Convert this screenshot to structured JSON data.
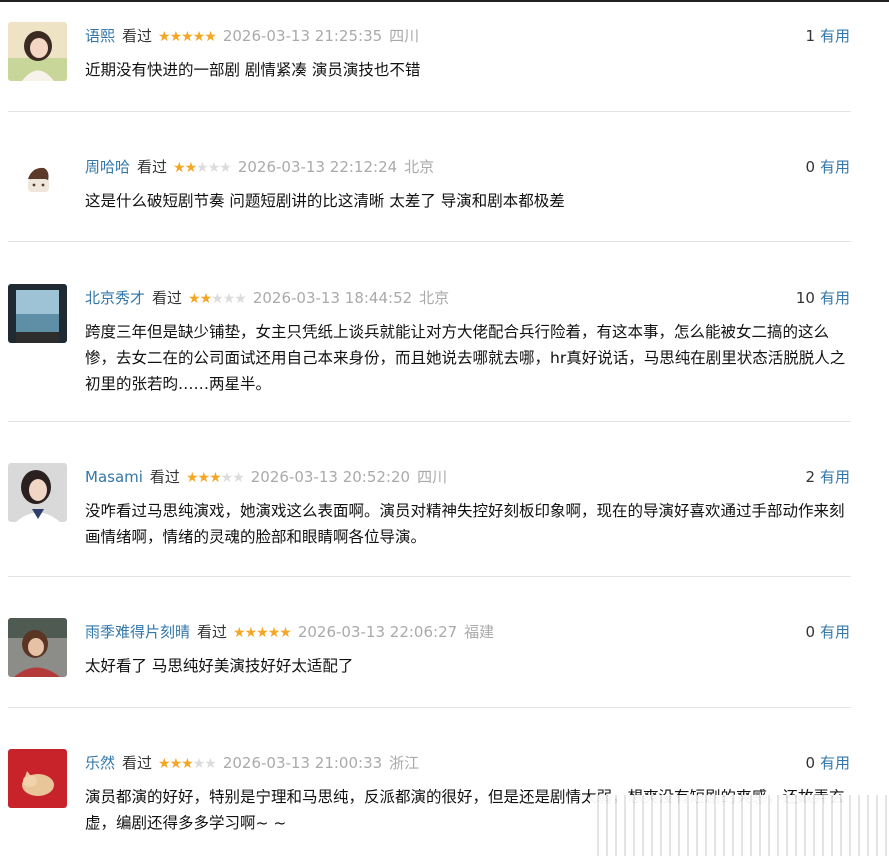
{
  "reviews": [
    {
      "name": "语熙",
      "watched": "看过",
      "stars": 5,
      "date": "2026-03-13 21:25:35",
      "location": "四川",
      "votes": "1",
      "useful": "有用",
      "content": "近期没有快进的一部剧 剧情紧凑 演员演技也不错"
    },
    {
      "name": "周哈哈",
      "watched": "看过",
      "stars": 2,
      "date": "2026-03-13 22:12:24",
      "location": "北京",
      "votes": "0",
      "useful": "有用",
      "content": "这是什么破短剧节奏 问题短剧讲的比这清晰 太差了 导演和剧本都极差"
    },
    {
      "name": "北京秀才",
      "watched": "看过",
      "stars": 2,
      "date": "2026-03-13 18:44:52",
      "location": "北京",
      "votes": "10",
      "useful": "有用",
      "content": "跨度三年但是缺少铺垫，女主只凭纸上谈兵就能让对方大佬配合兵行险着，有这本事，怎么能被女二搞的这么惨，去女二在的公司面试还用自己本来身份，而且她说去哪就去哪，hr真好说话，马思纯在剧里状态活脱脱人之初里的张若昀……两星半。"
    },
    {
      "name": "Masami",
      "watched": "看过",
      "stars": 3,
      "date": "2026-03-13 20:52:20",
      "location": "四川",
      "votes": "2",
      "useful": "有用",
      "content": "没咋看过马思纯演戏，她演戏这么表面啊。演员对精神失控好刻板印象啊，现在的导演好喜欢通过手部动作来刻画情绪啊，情绪的灵魂的脸部和眼睛啊各位导演。"
    },
    {
      "name": "雨季难得片刻晴",
      "watched": "看过",
      "stars": 5,
      "date": "2026-03-13 22:06:27",
      "location": "福建",
      "votes": "0",
      "useful": "有用",
      "content": "太好看了 马思纯好美演技好好太适配了"
    },
    {
      "name": "乐然",
      "watched": "看过",
      "stars": 3,
      "date": "2026-03-13 21:00:33",
      "location": "浙江",
      "votes": "0",
      "useful": "有用",
      "content": "演员都演的好好，特别是宁理和马思纯，反派都演的很好，但是还是剧情太弱，想爽没有短剧的爽感，还故弄玄虚，编剧还得多多学习啊~ ~"
    }
  ],
  "colors": {
    "link": "#3377aa",
    "star_on": "#f5a623",
    "star_off": "#dcdcdc",
    "meta": "#aaaaaa",
    "divider": "#e2e2e2"
  },
  "icons": {
    "star": "★"
  }
}
